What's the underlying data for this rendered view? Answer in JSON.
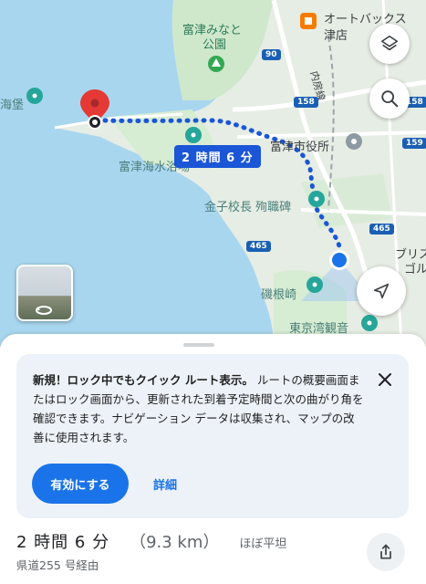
{
  "map": {
    "labels": {
      "futtsu_minato_park_line1": "富津みなと",
      "futtsu_minato_park_line2": "公園",
      "autobacs_line1": "オートバックス",
      "autobacs_line2": "津店",
      "uchibo_line": "内房線",
      "kaiho_partial": "海堡",
      "futtsu_city_hall": "富津市役所",
      "futtsu_suisan": "富津海水浴場",
      "kaneko_monument": "金子校長 殉職碑",
      "isonesaki": "磯根崎",
      "tokyo_bay_kannon": "東京湾観音",
      "bris_partial_1": "ブリス",
      "bris_partial_2": "ゴル"
    },
    "road_badges": [
      "90",
      "158",
      "158",
      "159",
      "465",
      "465"
    ],
    "route_callout": "2 時間 6 分",
    "colors": {
      "water": "#a9d6ef",
      "land": "#e8efe6",
      "park": "#c9e7c8",
      "route": "#1a56d6",
      "road": "#ffffff"
    }
  },
  "controls": {
    "layers_icon": "layers-icon",
    "search_icon": "search-icon",
    "navigate_icon": "navigation-arrow-icon",
    "streetview_icon": "360-rotate-icon"
  },
  "sheet": {
    "promo": {
      "title": "新規！ロック中でもクイック ルート表示。",
      "body": "ルートの概要画面またはロック画面から、更新された到着予定時間と次の曲がり角を確認できます。ナビゲーション データは収集され、マップの改善に使用されます。",
      "enable_label": "有効にする",
      "details_label": "詳細"
    },
    "summary": {
      "duration": "2 時間 6 分",
      "distance": "（9.3 km）",
      "elevation": "ほぼ平坦",
      "via": "県道255 号経由"
    }
  }
}
